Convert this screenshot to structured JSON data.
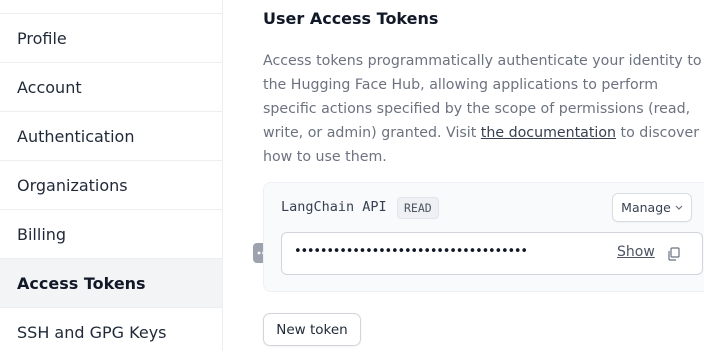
{
  "sidebar": {
    "items": [
      {
        "label": "Profile",
        "active": false
      },
      {
        "label": "Account",
        "active": false
      },
      {
        "label": "Authentication",
        "active": false
      },
      {
        "label": "Organizations",
        "active": false
      },
      {
        "label": "Billing",
        "active": false
      },
      {
        "label": "Access Tokens",
        "active": true
      },
      {
        "label": "SSH and GPG Keys",
        "active": false
      }
    ]
  },
  "main": {
    "title": "User Access Tokens",
    "description": {
      "text_before": "Access tokens programmatically authenticate your identity to the Hugging Face Hub, allowing applications to perform specific actions specified by the scope of permissions (read, write, or admin) granted. Visit ",
      "link_text": "the documentation",
      "text_after": " to discover how to use them."
    },
    "token": {
      "name": "LangChain API",
      "permission": "READ",
      "manage_label": "Manage",
      "masked_value": "••••••••••••••••••••••••••••••••••••",
      "show_label": "Show"
    },
    "new_token_label": "New token"
  },
  "icons": {
    "manage_chevron": "chevron-down-icon",
    "copy": "copy-icon",
    "drag": "drag-handle-icon"
  },
  "colors": {
    "active_bg": "#f3f4f6",
    "card_bg": "#f9fafb",
    "muted_text": "#6b7280"
  }
}
